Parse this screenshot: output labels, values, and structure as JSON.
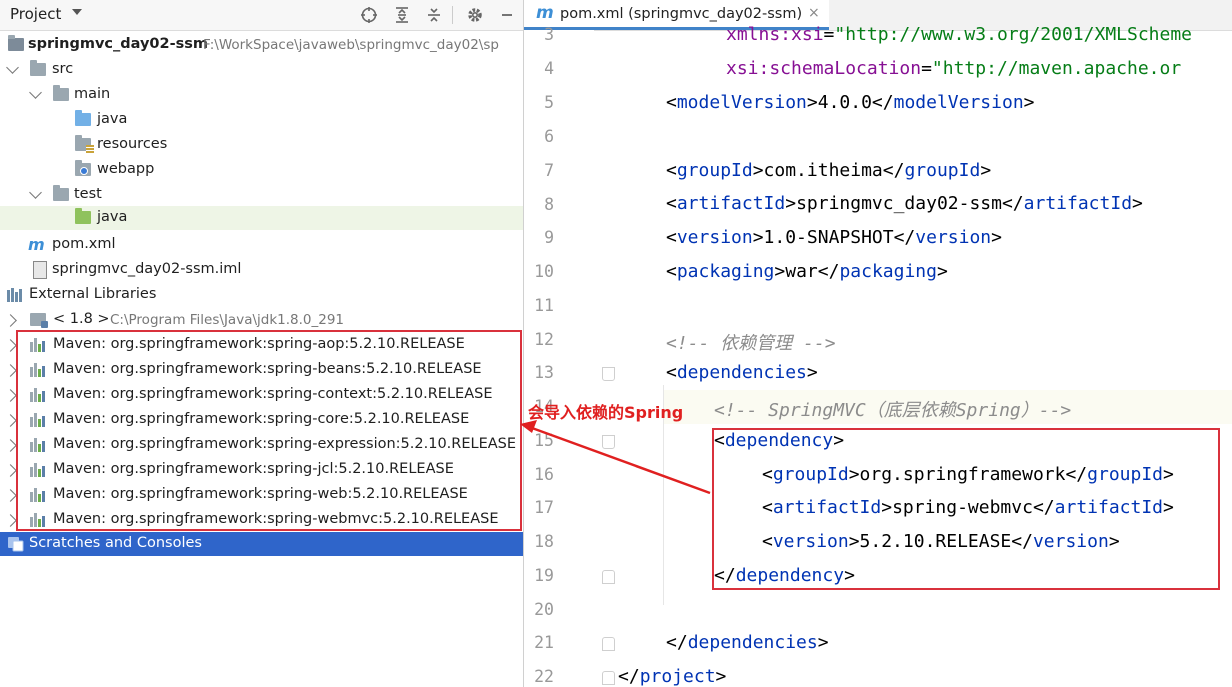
{
  "project_panel": {
    "title": "Project",
    "rows": [
      {
        "label": "springmvc_day02-ssm",
        "path": "F:\\WorkSpace\\javaweb\\springmvc_day02\\sp"
      },
      {
        "label": "src"
      },
      {
        "label": "main"
      },
      {
        "label": "java"
      },
      {
        "label": "resources"
      },
      {
        "label": "webapp"
      },
      {
        "label": "test"
      },
      {
        "label": "java"
      },
      {
        "label": "pom.xml"
      },
      {
        "label": "springmvc_day02-ssm.iml"
      },
      {
        "label": "External Libraries"
      },
      {
        "label": "< 1.8 >",
        "path": "C:\\Program Files\\Java\\jdk1.8.0_291"
      },
      {
        "label": "Maven: org.springframework:spring-aop:5.2.10.RELEASE"
      },
      {
        "label": "Maven: org.springframework:spring-beans:5.2.10.RELEASE"
      },
      {
        "label": "Maven: org.springframework:spring-context:5.2.10.RELEASE"
      },
      {
        "label": "Maven: org.springframework:spring-core:5.2.10.RELEASE"
      },
      {
        "label": "Maven: org.springframework:spring-expression:5.2.10.RELEASE"
      },
      {
        "label": "Maven: org.springframework:spring-jcl:5.2.10.RELEASE"
      },
      {
        "label": "Maven: org.springframework:spring-web:5.2.10.RELEASE"
      },
      {
        "label": "Maven: org.springframework:spring-webmvc:5.2.10.RELEASE"
      },
      {
        "label": "Scratches and Consoles"
      }
    ]
  },
  "editor": {
    "tab_label": "pom.xml (springmvc_day02-ssm)",
    "tab_close": "×",
    "line_numbers": [
      "3",
      "4",
      "5",
      "6",
      "7",
      "8",
      "9",
      "10",
      "11",
      "12",
      "13",
      "14",
      "15",
      "16",
      "17",
      "18",
      "19",
      "20",
      "21",
      "22"
    ],
    "lines": {
      "l3": {
        "attr": "xmlns:xsi",
        "eq": "=",
        "val": "\"http://www.w3.org/2001/XMLScheme"
      },
      "l4": {
        "attr": "xsi:schemaLocation",
        "eq": "=",
        "val": "\"http://maven.apache.or"
      },
      "l5": {
        "open": "modelVersion",
        "text": "4.0.0",
        "close": "modelVersion"
      },
      "l7": {
        "open": "groupId",
        "text": "com.itheima",
        "close": "groupId"
      },
      "l8": {
        "open": "artifactId",
        "text": "springmvc_day02-ssm",
        "close": "artifactId"
      },
      "l9": {
        "open": "version",
        "text": "1.0-SNAPSHOT",
        "close": "version"
      },
      "l10": {
        "open": "packaging",
        "text": "war",
        "close": "packaging"
      },
      "l12": {
        "comment": "<!-- 依赖管理 -->"
      },
      "l13": {
        "open": "dependencies"
      },
      "l14": {
        "comment": "<!-- SpringMVC（底层依赖Spring）-->"
      },
      "l15": {
        "open": "dependency"
      },
      "l16": {
        "open": "groupId",
        "text": "org.springframework",
        "close": "groupId"
      },
      "l17": {
        "open": "artifactId",
        "text": "spring-webmvc",
        "close": "artifactId"
      },
      "l18": {
        "open": "version",
        "text": "5.2.10.RELEASE",
        "close": "version"
      },
      "l19": {
        "close": "dependency"
      },
      "l21": {
        "close": "dependencies"
      },
      "l22": {
        "close": "project"
      }
    }
  },
  "annotation": {
    "text": "会导入依赖的Spring",
    "color": "#e02020"
  },
  "icons": [
    "project-caret-icon",
    "locate-icon",
    "expand-all-icon",
    "collapse-all-icon",
    "gear-icon",
    "minimize-icon",
    "module-icon",
    "folder-icon",
    "maven-m-icon",
    "iml-file-icon",
    "libraries-icon",
    "jdk-icon",
    "maven-library-icon",
    "close-icon"
  ],
  "colors": {
    "selection": "#2f65ca",
    "tag": "#0033b3",
    "attribute": "#871094",
    "string": "#067d17",
    "comment": "#8c8c8c",
    "highlight_box": "#d9313c"
  }
}
